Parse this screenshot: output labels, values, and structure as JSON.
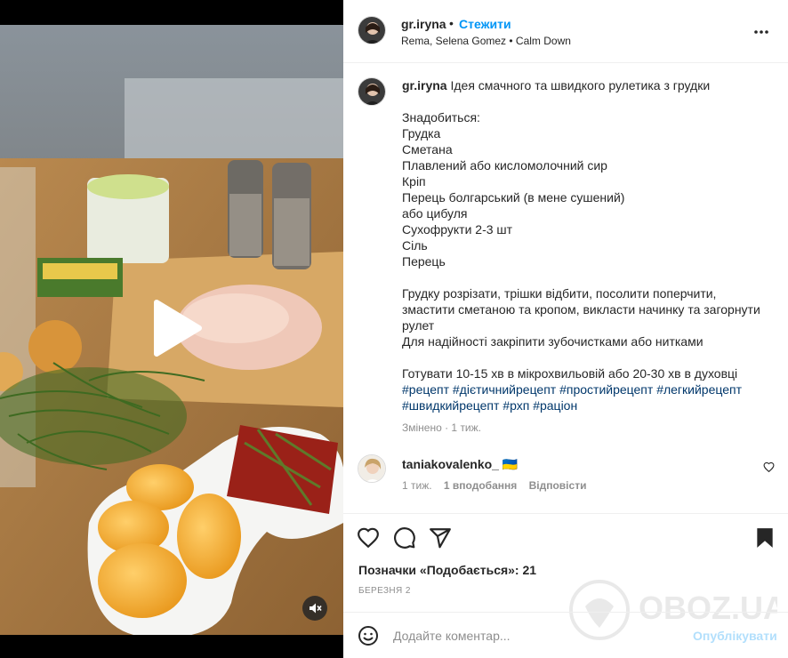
{
  "post": {
    "author": {
      "username": "gr.iryna",
      "follow_label": "Стежити",
      "audio": "Rema, Selena Gomez • Calm Down"
    },
    "caption": {
      "username": "gr.iryna",
      "lines": [
        "Ідея смачного та швидкого рулетика з грудки",
        "",
        "Знадобиться:",
        "Грудка",
        "Сметана",
        "Плавлений або кисломолочний сир",
        "Кріп",
        "Перець болгарський (в мене сушений)",
        "або цибуля",
        "Сухофрукти 2-3 шт",
        "Сіль",
        "Перець",
        "",
        "Грудку розрізати, трішки відбити, посолити поперчити,",
        "змастити сметаною та кропом, викласти начинку та загорнути",
        "рулет",
        "Для надійності закріпити зубочистками або нитками",
        "",
        "Готувати 10-15 хв в мікрохвильовій або 20-30 хв в духовці"
      ],
      "hashtags_line1": "#рецепт #дієтичнийрецепт #простийрецепт #легкийрецепт",
      "hashtags_line2": "#швидкийрецепт #рхп #раціон",
      "edited_meta": "Змінено · 1 тиж."
    },
    "comment": {
      "username": "taniakovalenko_ 🇺🇦",
      "time": "1 тиж.",
      "likes": "1 вподобання",
      "reply_label": "Відповісти"
    },
    "likes_text": "Позначки «Подобається»: 21",
    "date": "БЕРЕЗНЯ 2",
    "comment_input": {
      "placeholder": "Додайте коментар...",
      "value": ""
    },
    "publish_label": "Опублікувати",
    "watermark_text": "OBOZ.UA"
  },
  "icons": {
    "play": "play-icon",
    "mute": "muted-speaker-icon",
    "more": "more-horizontal-icon",
    "like": "heart-icon",
    "comment": "comment-bubble-icon",
    "share": "paper-plane-icon",
    "save": "bookmark-icon",
    "emoji": "smiley-icon"
  },
  "colors": {
    "accent": "#0095f6",
    "hashtag": "#00376b",
    "muted_text": "#8e8e8e",
    "publish_disabled": "#b2dffc"
  }
}
